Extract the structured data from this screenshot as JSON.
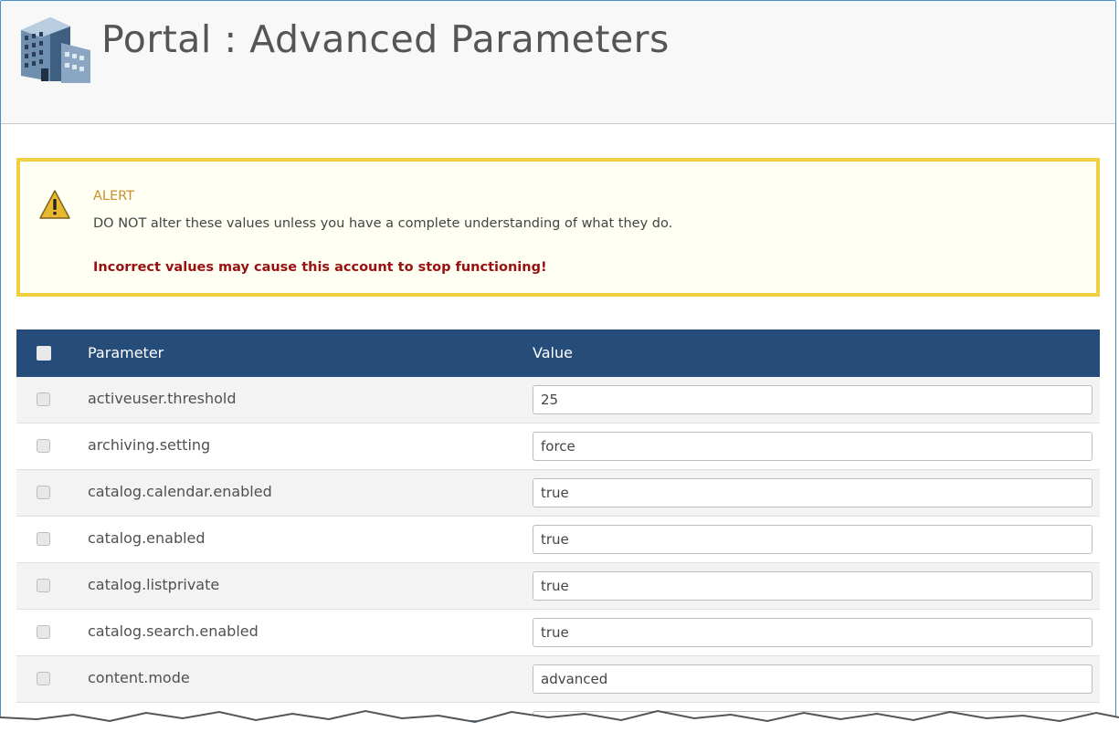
{
  "header": {
    "title": "Portal : Advanced Parameters",
    "logo_icon": "office-building-icon"
  },
  "alert": {
    "icon": "warning-triangle-icon",
    "title": "ALERT",
    "message": "DO NOT alter these values unless you have a complete understanding of what they do.",
    "warning": "Incorrect values may cause this account to stop functioning!"
  },
  "table": {
    "columns": {
      "parameter": "Parameter",
      "value": "Value"
    },
    "rows": [
      {
        "name": "activeuser.threshold",
        "value": "25"
      },
      {
        "name": "archiving.setting",
        "value": "force"
      },
      {
        "name": "catalog.calendar.enabled",
        "value": "true"
      },
      {
        "name": "catalog.enabled",
        "value": "true"
      },
      {
        "name": "catalog.listprivate",
        "value": "true"
      },
      {
        "name": "catalog.search.enabled",
        "value": "true"
      },
      {
        "name": "content.mode",
        "value": "advanced"
      },
      {
        "name": "",
        "value": ""
      }
    ]
  },
  "colors": {
    "header_bar": "#264d7a",
    "alert_border": "#f0d040",
    "alert_title": "#c8902a",
    "warning_text": "#9a1010",
    "frame_border": "#4a90c8"
  }
}
